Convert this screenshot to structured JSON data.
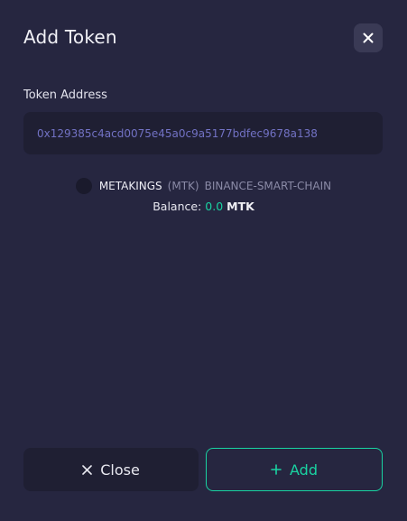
{
  "dialog": {
    "title": "Add Token"
  },
  "token_address": {
    "label": "Token Address",
    "value": "0x129385c4acd0075e45a0c9a5177bdfec9678a138"
  },
  "token": {
    "name": "METAKINGS",
    "symbol": "(MTK)",
    "chain": "BINANCE-SMART-CHAIN",
    "balance_label": "Balance:",
    "balance_value": "0.0",
    "balance_unit": "MTK"
  },
  "buttons": {
    "close_label": "Close",
    "add_label": "Add"
  },
  "colors": {
    "background": "#262640",
    "field": "#1f1f33",
    "accent": "#19d3a2",
    "address_text": "#7272c4"
  }
}
